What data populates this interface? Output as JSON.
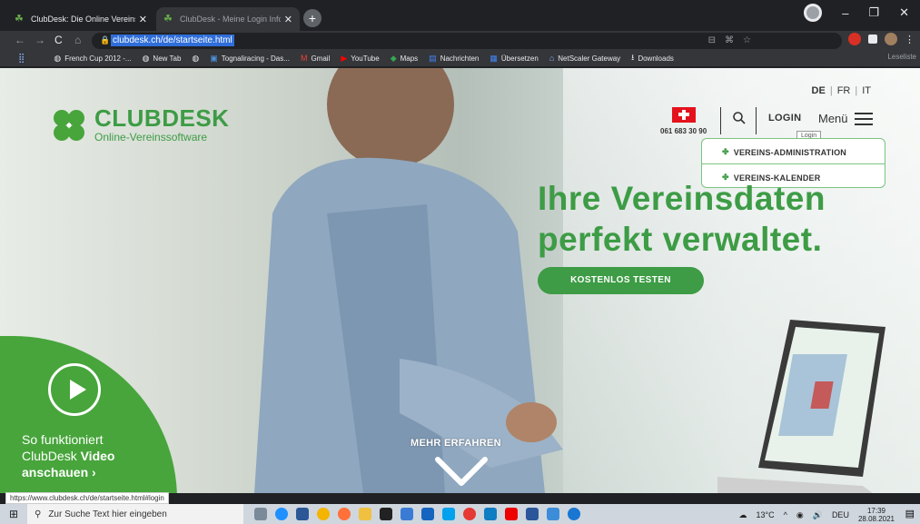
{
  "browser": {
    "tabs": [
      {
        "title": "ClubDesk: Die Online Vereinssoft",
        "active": false
      },
      {
        "title": "ClubDesk - Meine Login Informa",
        "active": true
      }
    ],
    "new_tab": "+",
    "url": "clubdesk.ch/de/startseite.html",
    "status_url": "https://www.clubdesk.ch/de/startseite.html#login",
    "bookmarks": [
      "French Cup 2012 -...",
      "New Tab",
      "Tognaliracing - Das...",
      "Gmail",
      "YouTube",
      "Maps",
      "Nachrichten",
      "Übersetzen",
      "NetScaler Gateway",
      "Downloads"
    ],
    "reading_list": "Leseliste"
  },
  "site": {
    "brand": "CLUBDESK",
    "tagline": "Online-Vereinssoftware",
    "languages": [
      "DE",
      "FR",
      "IT"
    ],
    "active_language": "DE",
    "phone": "061 683 30 90",
    "login": "LOGIN",
    "menu": "Menü",
    "tooltip": "Login",
    "dropdown": [
      "VEREINS-ADMINISTRATION",
      "VEREINS-KALENDER"
    ],
    "headline_line1": "Ihre Vereinsdaten",
    "headline_line2": "perfekt verwaltet.",
    "cta": "KOSTENLOS TESTEN",
    "video_line1": "So funktioniert",
    "video_line2a": "ClubDesk ",
    "video_line2b": "Video",
    "video_line3": "anschauen ›",
    "more": "MEHR ERFAHREN",
    "colors": {
      "brand_green": "#3d9c45",
      "swiss_red": "#e4121c"
    }
  },
  "taskbar": {
    "search_placeholder": "Zur Suche Text hier eingeben",
    "weather": "13°C",
    "language": "DEU",
    "time": "17:39",
    "date": "28.08.2021"
  }
}
